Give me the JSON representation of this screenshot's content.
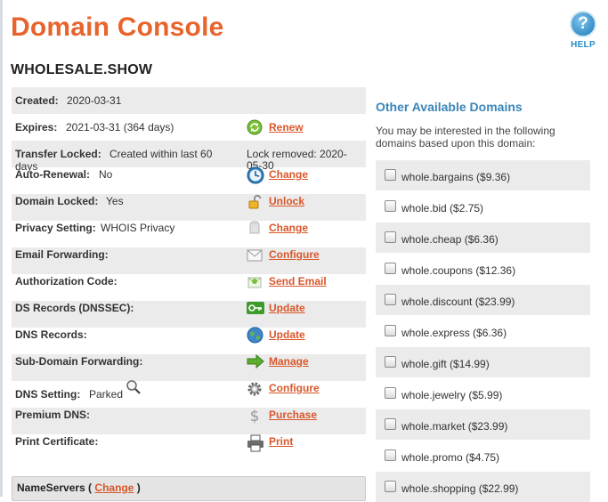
{
  "header": {
    "title": "Domain Console",
    "help_label": "HELP",
    "help_glyph": "?",
    "domain": "WHOLESALE.SHOW"
  },
  "details": {
    "created": {
      "label": "Created:",
      "value": "2020-03-31"
    },
    "expires": {
      "label": "Expires:",
      "value": "2021-03-31 (364 days)",
      "action": "Renew",
      "icon": "renew-icon"
    },
    "transfer_locked": {
      "label": "Transfer Locked:",
      "value": "Created within last 60 days",
      "note": "Lock removed: 2020-05-30"
    },
    "auto_renewal": {
      "label": "Auto-Renewal:",
      "value": "No",
      "action": "Change",
      "icon": "clock-icon"
    },
    "domain_locked": {
      "label": "Domain Locked:",
      "value": "Yes",
      "action": "Unlock",
      "icon": "lock-icon"
    },
    "privacy": {
      "label": "Privacy Setting:",
      "value": "WHOIS Privacy",
      "action": "Change",
      "icon": "privacy-icon"
    },
    "email_forwarding": {
      "label": "Email Forwarding:",
      "action": "Configure",
      "icon": "envelope-icon"
    },
    "auth_code": {
      "label": "Authorization Code:",
      "action": "Send Email",
      "icon": "send-email-icon"
    },
    "ds_records": {
      "label": "DS Records (DNSSEC):",
      "action": "Update",
      "icon": "key-icon"
    },
    "dns_records": {
      "label": "DNS Records:",
      "action": "Update",
      "icon": "globe-icon"
    },
    "subdomain_forwarding": {
      "label": "Sub-Domain Forwarding:",
      "action": "Manage",
      "icon": "arrow-right-icon"
    },
    "dns_setting": {
      "label": "DNS Setting:",
      "value": "Parked",
      "action": "Configure",
      "icon": "gear-icon"
    },
    "premium_dns": {
      "label": "Premium DNS:",
      "action": "Purchase",
      "icon": "dollar-icon"
    },
    "print_certificate": {
      "label": "Print Certificate:",
      "action": "Print",
      "icon": "printer-icon"
    }
  },
  "nameservers": {
    "label_prefix": "NameServers (",
    "link": "Change",
    "label_suffix": ")"
  },
  "other_domains": {
    "title": "Other Available Domains",
    "description": "You may be interested in the following domains based upon this domain:",
    "items": [
      "whole.bargains ($9.36)",
      "whole.bid ($2.75)",
      "whole.cheap ($6.36)",
      "whole.coupons ($12.36)",
      "whole.discount ($23.99)",
      "whole.express ($6.36)",
      "whole.gift ($14.99)",
      "whole.jewelry ($5.99)",
      "whole.market ($23.99)",
      "whole.promo ($4.75)",
      "whole.shopping ($22.99)"
    ]
  },
  "colors": {
    "title": "#e8642c",
    "link": "#d9572b",
    "heading": "#3a85b8",
    "row_shade": "#ebebeb"
  }
}
